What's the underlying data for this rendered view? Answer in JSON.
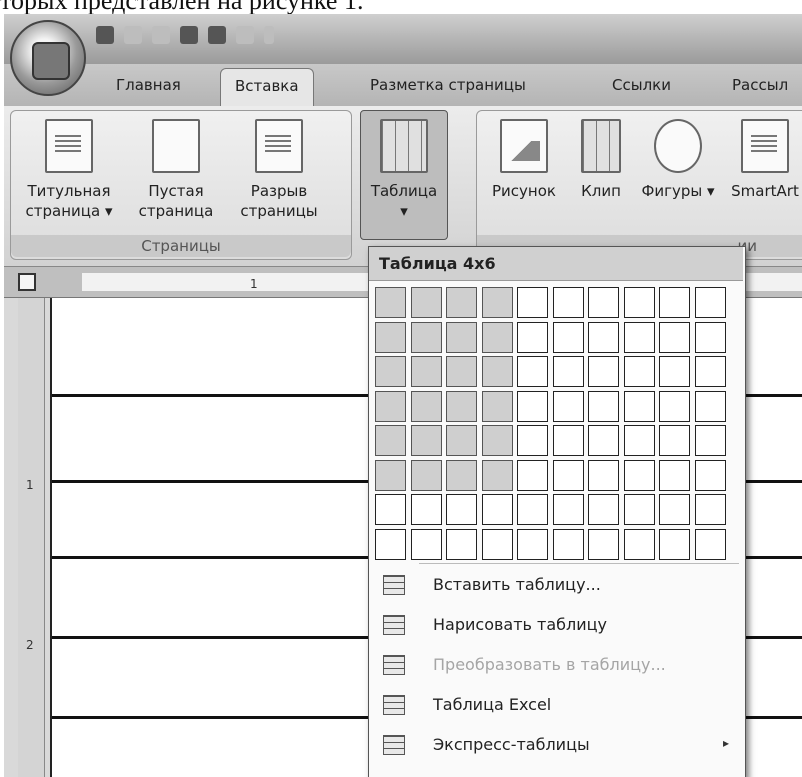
{
  "caption": "торых представлен на рисунке 1.",
  "tabs": [
    "Главная",
    "Вставка",
    "Разметка страницы",
    "Ссылки",
    "Рассыл"
  ],
  "ribbon": {
    "pages_group": {
      "label": "Страницы",
      "buttons": [
        {
          "line1": "Титульная",
          "line2": "страница ▾"
        },
        {
          "line1": "Пустая",
          "line2": "страница"
        },
        {
          "line1": "Разрыв",
          "line2": "страницы"
        }
      ]
    },
    "table_button": {
      "label": "Таблица",
      "arrow": "▾"
    },
    "illustrations": [
      {
        "label": "Рисунок"
      },
      {
        "label": "Клип"
      },
      {
        "label": "Фигуры ▾"
      },
      {
        "label": "SmartArt"
      }
    ],
    "illustrations_group_label": "ии"
  },
  "ruler": {
    "mark": "1",
    "vmarks": [
      "1",
      "2"
    ]
  },
  "dropdown": {
    "title": "Таблица 4x6",
    "grid": {
      "rows": 8,
      "cols": 10,
      "selected_rows": 6,
      "selected_cols": 4
    },
    "menu": [
      {
        "label": "Вставить таблицу...",
        "icon": "insert-table-icon",
        "disabled": false
      },
      {
        "label": "Нарисовать таблицу",
        "icon": "draw-table-icon",
        "disabled": false
      },
      {
        "label": "Преобразовать в таблицу...",
        "icon": "convert-table-icon",
        "disabled": true
      },
      {
        "label": "Таблица Excel",
        "icon": "excel-table-icon",
        "disabled": false
      },
      {
        "label": "Экспресс-таблицы",
        "icon": "quick-tables-icon",
        "disabled": false,
        "submenu_arrow": "▸"
      }
    ]
  }
}
